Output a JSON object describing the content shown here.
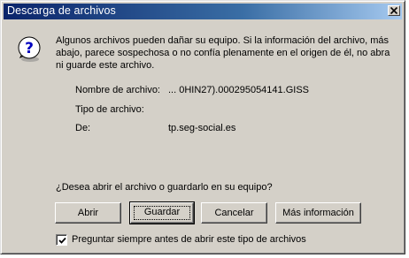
{
  "window": {
    "title": "Descarga de archivos",
    "close_icon": "close-icon"
  },
  "message": {
    "icon": "question-icon",
    "text": "Algunos archivos pueden dañar su equipo. Si la información del archivo, más abajo, parece sospechosa o no confía plenamente en el origen de él, no abra ni guarde este archivo."
  },
  "file_info": {
    "name_label": "Nombre de archivo:",
    "name_value": "... 0HIN27).000295054141.GISS",
    "type_label": "Tipo de archivo:",
    "type_value": "",
    "from_label": "De:",
    "from_value": "tp.seg-social.es"
  },
  "prompt": "¿Desea abrir el archivo o guardarlo en su equipo?",
  "buttons": {
    "open": "Abrir",
    "save": "Guardar",
    "cancel": "Cancelar",
    "more_info": "Más información"
  },
  "always_ask": {
    "label": "Preguntar siempre antes de abrir este tipo de archivos",
    "checked": true
  },
  "colors": {
    "titlebar_start": "#0a246a",
    "titlebar_end": "#a6caf0",
    "face": "#d4d0c8"
  }
}
